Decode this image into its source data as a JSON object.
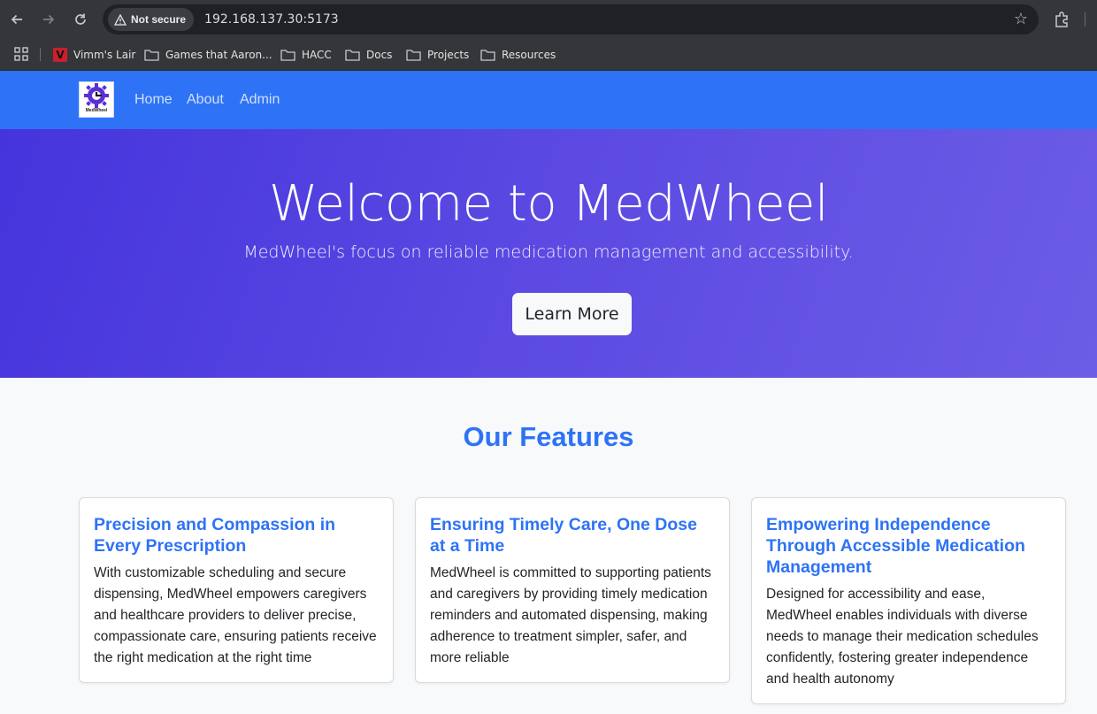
{
  "browser": {
    "security_label": "Not secure",
    "url": "192.168.137.30:5173",
    "bookmarks": [
      "Vimm's Lair",
      "Games that Aaron...",
      "HACC",
      "Docs",
      "Projects",
      "Resources"
    ]
  },
  "nav": {
    "logo_text": "MedWheel",
    "links": [
      "Home",
      "About",
      "Admin"
    ]
  },
  "hero": {
    "title": "Welcome to MedWheel",
    "subtitle": "MedWheel's focus on reliable medication management and accessibility.",
    "button_label": "Learn More"
  },
  "features": {
    "heading": "Our Features",
    "cards": [
      {
        "title": "Precision and Compassion in Every Prescription",
        "text": "With customizable scheduling and secure dispensing, MedWheel empowers caregivers and healthcare providers to deliver precise, compassionate care, ensuring patients receive the right medication at the right time"
      },
      {
        "title": "Ensuring Timely Care, One Dose at a Time",
        "text": "MedWheel is committed to supporting patients and caregivers by providing timely medication reminders and automated dispensing, making adherence to treatment simpler, safer, and more reliable"
      },
      {
        "title": "Empowering Independence Through Accessible Medication Management",
        "text": "Designed for accessibility and ease, MedWheel enables individuals with diverse needs to manage their medication schedules confidently, fostering greater independence and health autonomy"
      }
    ]
  },
  "colors": {
    "nav_bg": "#2e73f5",
    "hero_start": "#4534dc",
    "hero_end": "#6c5de6",
    "accent": "#2e73f5",
    "page_bg": "#f8f9fa"
  }
}
